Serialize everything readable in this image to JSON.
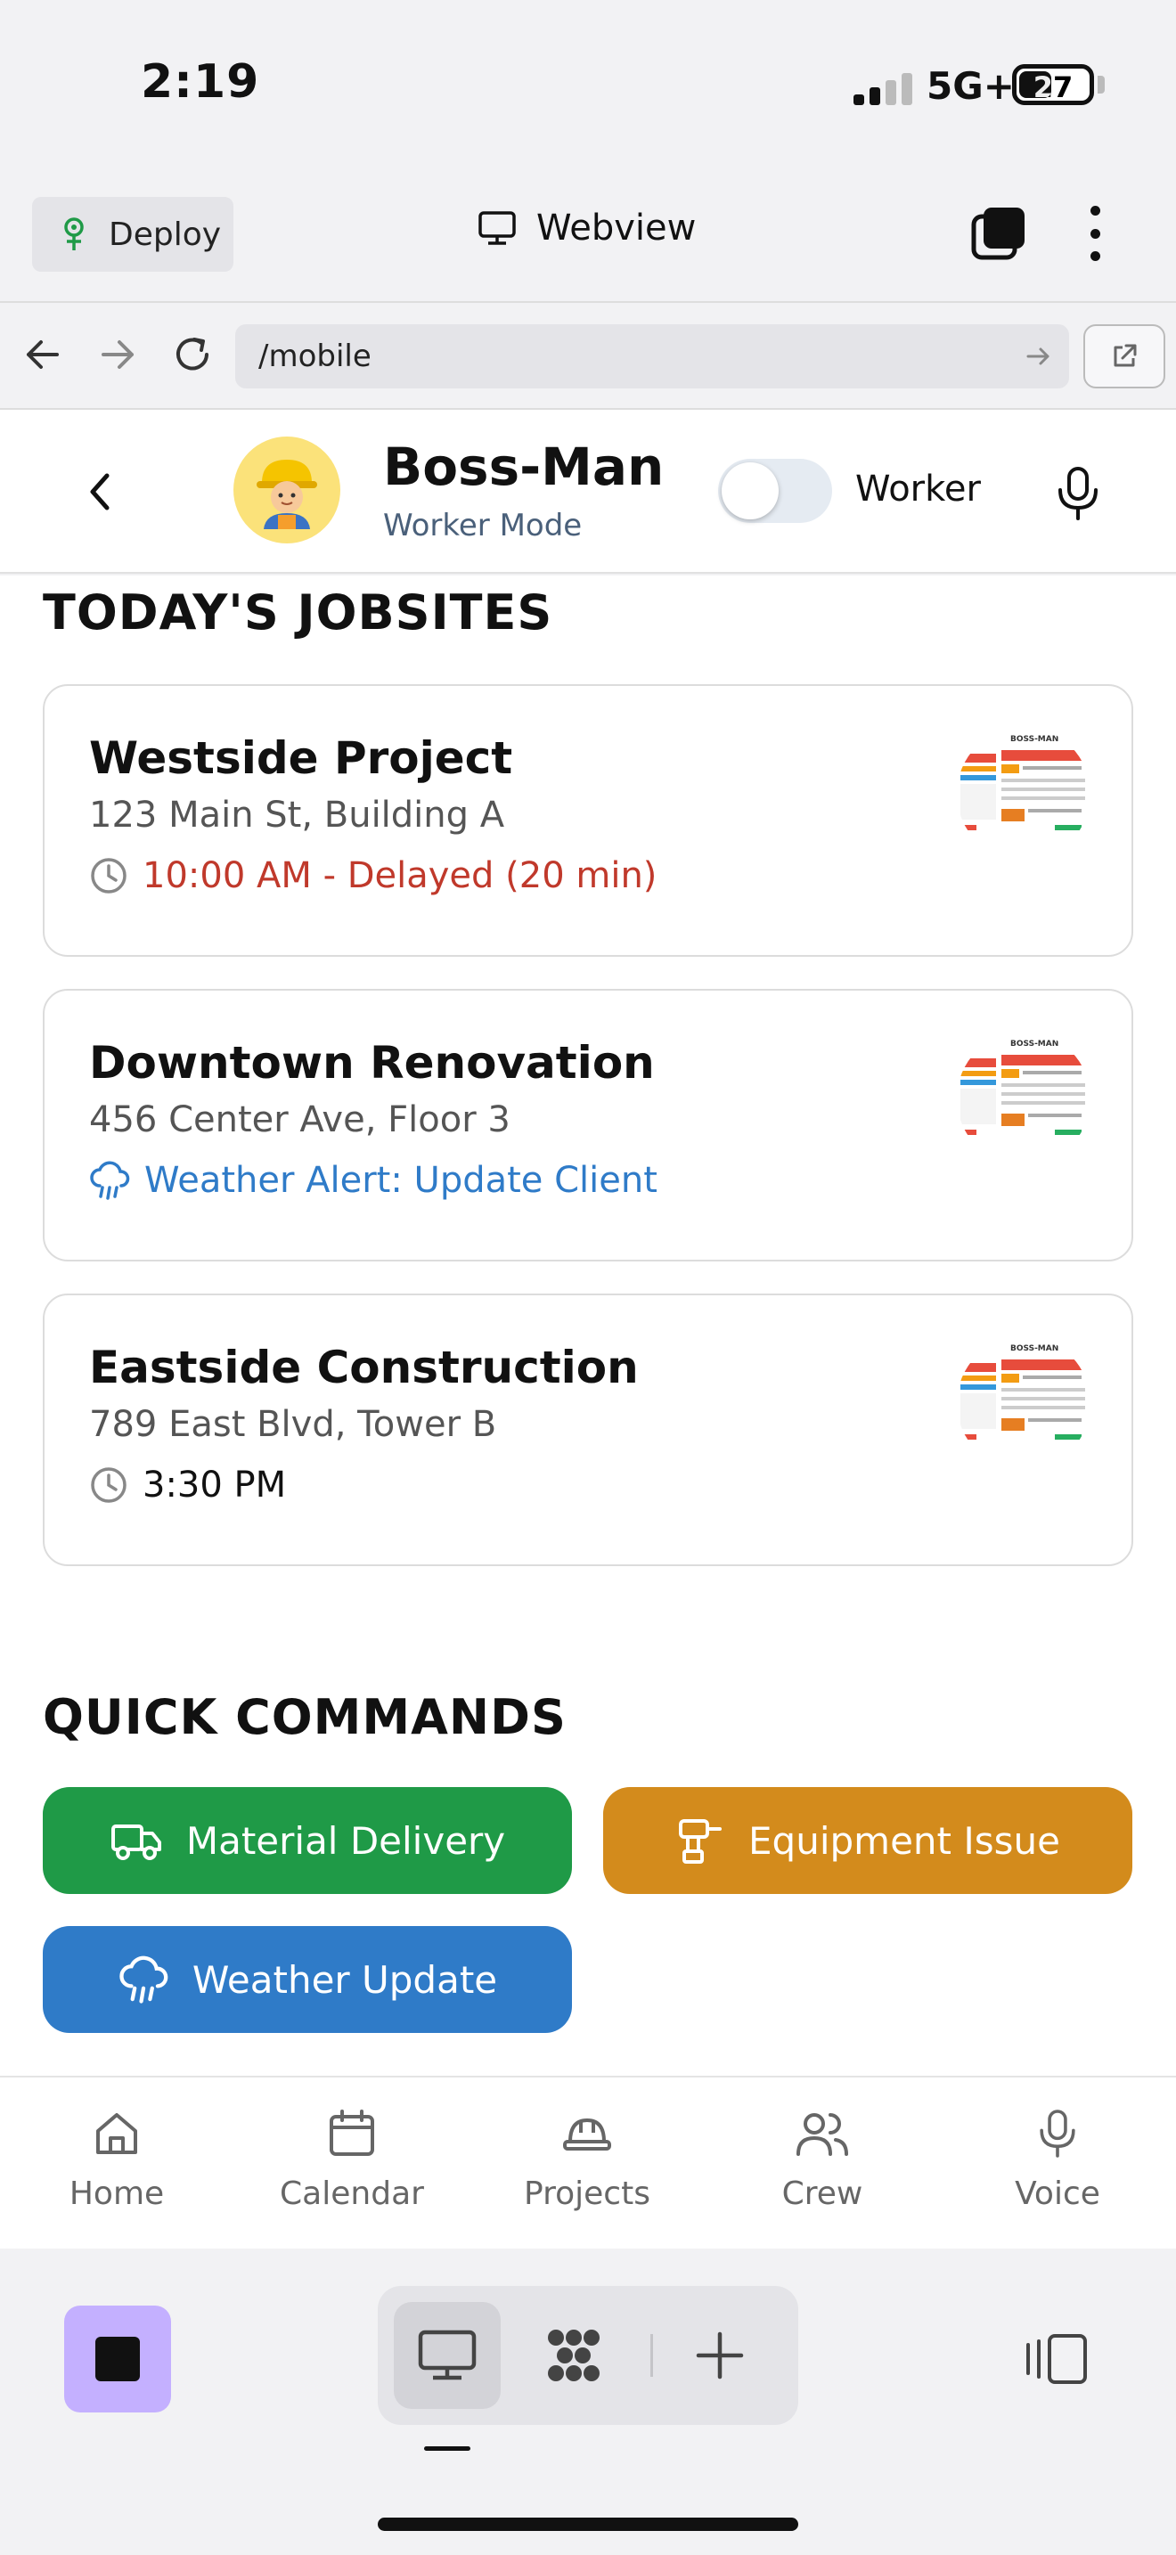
{
  "status_bar": {
    "time": "2:19",
    "network": "5G+",
    "battery": "27"
  },
  "app_bar": {
    "deploy_label": "Deploy",
    "webview_label": "Webview"
  },
  "url_bar": {
    "path": "/mobile"
  },
  "header": {
    "title": "Boss-Man",
    "subtitle": "Worker Mode",
    "toggle_label": "Worker",
    "avatar_emoji": "👷‍♀️"
  },
  "jobsites": {
    "title": "TODAY'S JOBSITES",
    "items": [
      {
        "name": "Westside Project",
        "address": "123 Main St, Building A",
        "status": "10:00 AM - Delayed (20 min)",
        "status_icon": "clock-icon",
        "status_color": "#c0392b"
      },
      {
        "name": "Downtown Renovation",
        "address": "456 Center Ave, Floor 3",
        "status": "Weather Alert: Update Client",
        "status_icon": "cloud-rain-icon",
        "status_color": "#2f7bc8"
      },
      {
        "name": "Eastside Construction",
        "address": "789 East Blvd, Tower B",
        "status": "3:30 PM",
        "status_icon": "clock-icon",
        "status_color": "#111111"
      }
    ],
    "thumb_title": "BOSS-MAN"
  },
  "quick_commands": {
    "title": "QUICK COMMANDS",
    "items": [
      {
        "label": "Material Delivery",
        "icon": "truck-icon",
        "color": "#1f9a47"
      },
      {
        "label": "Equipment Issue",
        "icon": "drill-icon",
        "color": "#d38b1c"
      },
      {
        "label": "Weather Update",
        "icon": "cloud-rain-icon",
        "color": "#2f7bc8"
      }
    ]
  },
  "bottom_nav": {
    "items": [
      {
        "label": "Home",
        "icon": "home-icon"
      },
      {
        "label": "Calendar",
        "icon": "calendar-icon"
      },
      {
        "label": "Projects",
        "icon": "hardhat-icon"
      },
      {
        "label": "Crew",
        "icon": "users-icon"
      },
      {
        "label": "Voice",
        "icon": "mic-icon"
      }
    ]
  },
  "colors": {
    "stop_button": "#c4b0ff",
    "accent_blue": "#2f7bc8"
  }
}
